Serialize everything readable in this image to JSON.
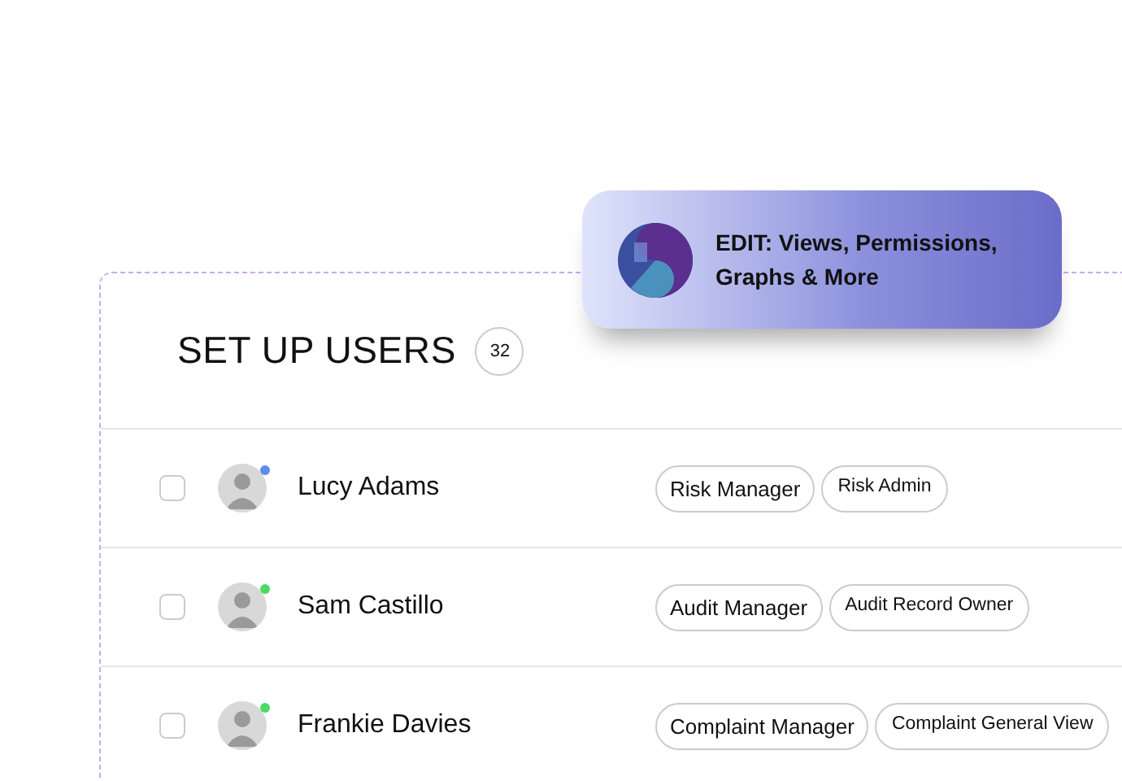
{
  "callout": {
    "text": "EDIT: Views, Permissions, Graphs & More"
  },
  "header": {
    "title": "SET UP USERS",
    "count": "32"
  },
  "users": [
    {
      "name": "Lucy Adams",
      "checked": false,
      "color": "#5b8def",
      "roles": [
        "Risk Manager",
        "Risk Admin"
      ]
    },
    {
      "name": "Sam Castillo",
      "checked": false,
      "color": "#4cd964",
      "roles": [
        "Audit Manager",
        "Audit Record Owner"
      ]
    },
    {
      "name": "Frankie Davies",
      "checked": false,
      "color": "#4cd964",
      "roles": [
        "Complaint Manager",
        "Complaint General View"
      ]
    }
  ]
}
